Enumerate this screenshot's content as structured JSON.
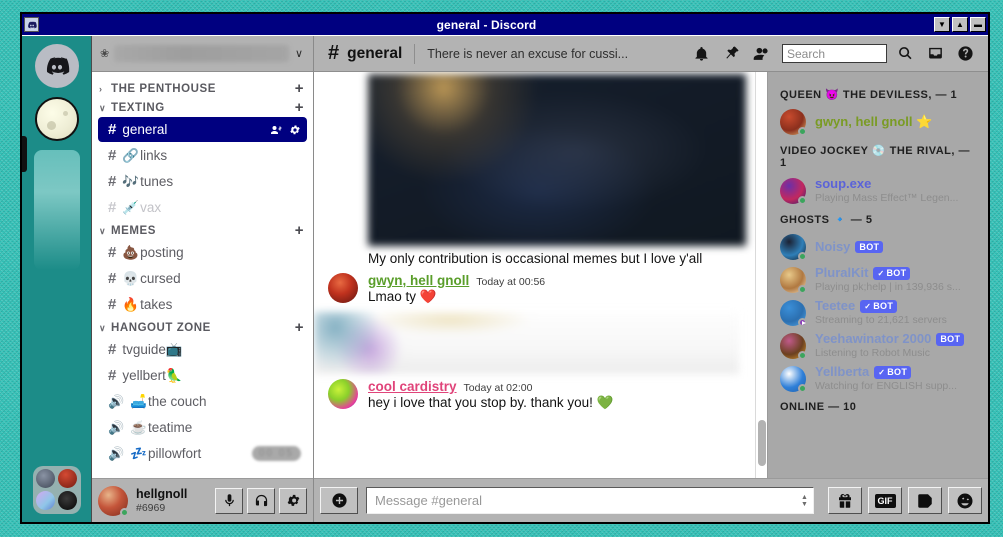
{
  "window": {
    "title": "general - Discord",
    "icon": "discord-icon",
    "buttons": [
      {
        "name": "minimize",
        "glyph": "▼"
      },
      {
        "name": "maximize",
        "glyph": "▲"
      },
      {
        "name": "close",
        "glyph": "▬"
      }
    ]
  },
  "server_rail": {
    "home_label": "Discord Home",
    "guilds": [
      {
        "name": "home"
      },
      {
        "name": "moon-server"
      },
      {
        "name": "faded-server"
      }
    ],
    "folder": {
      "name": "server-folder",
      "colors": [
        "#5b6470",
        "#a03028",
        "#cf7fe8",
        "#1a1a1a"
      ]
    }
  },
  "guild_header": {
    "emoji": "❀",
    "name": "",
    "chevron": "∨"
  },
  "channels": [
    {
      "category": "THE PENTHOUSE",
      "collapsed": true,
      "arrow": "›",
      "plus": "+",
      "items": []
    },
    {
      "category": "TEXTING",
      "collapsed": false,
      "arrow": "∨",
      "plus": "+",
      "items": [
        {
          "type": "text",
          "emoji": "",
          "name": "general",
          "active": true,
          "muted": false,
          "actions": [
            "create-invite-icon",
            "edit-channel-icon"
          ]
        },
        {
          "type": "text",
          "emoji": "🔗",
          "name": "links",
          "active": false,
          "muted": false
        },
        {
          "type": "text",
          "emoji": "🎶",
          "name": "tunes",
          "active": false,
          "muted": false
        },
        {
          "type": "text",
          "emoji": "💉",
          "name": "vax",
          "active": false,
          "muted": true
        }
      ]
    },
    {
      "category": "MEMES",
      "collapsed": false,
      "arrow": "∨",
      "plus": "+",
      "items": [
        {
          "type": "text",
          "emoji": "💩",
          "name": "posting",
          "active": false,
          "muted": false
        },
        {
          "type": "text",
          "emoji": "💀",
          "name": "cursed",
          "active": false,
          "muted": false
        },
        {
          "type": "text",
          "emoji": "🔥",
          "name": "takes",
          "active": false,
          "muted": false
        }
      ]
    },
    {
      "category": "HANGOUT ZONE",
      "collapsed": false,
      "arrow": "∨",
      "plus": "+",
      "items": [
        {
          "type": "text",
          "emoji": "",
          "name": "tvguide📺",
          "active": false,
          "muted": false
        },
        {
          "type": "text",
          "emoji": "",
          "name": "yellbert🦜",
          "active": false,
          "muted": false
        },
        {
          "type": "voice",
          "emoji": "🛋️",
          "name": "the couch",
          "active": false,
          "muted": false
        },
        {
          "type": "voice",
          "emoji": "☕",
          "name": "teatime",
          "active": false,
          "muted": false
        },
        {
          "type": "voice",
          "emoji": "💤",
          "name": "pillowfort",
          "active": false,
          "muted": false,
          "badge": "00  05"
        }
      ]
    }
  ],
  "user_panel": {
    "username": "hellgnoll",
    "discriminator": "#6969",
    "status": "online",
    "buttons": [
      {
        "name": "mute-button",
        "icon": "microphone-icon"
      },
      {
        "name": "deafen-button",
        "icon": "headphones-icon"
      },
      {
        "name": "user-settings-button",
        "icon": "gear-icon"
      }
    ]
  },
  "chat_header": {
    "hash": "#",
    "channel_name": "general",
    "topic": "There is never an excuse for cussi...",
    "icons": [
      {
        "name": "notifications-bell-icon"
      },
      {
        "name": "pinned-messages-icon"
      },
      {
        "name": "member-list-icon"
      }
    ],
    "search": {
      "placeholder": "Search",
      "icon": "search-icon"
    },
    "inbox_icon": "inbox-icon",
    "help_icon": "help-icon"
  },
  "messages": [
    {
      "type": "image-embed",
      "name": "image-attachment-dark",
      "author": "",
      "time": "",
      "content": ""
    },
    {
      "type": "text-continuation",
      "name": "message-text",
      "content": "My only contribution is occasional memes but I love y'all"
    },
    {
      "type": "message",
      "author": "gwyn, hell gnoll",
      "author_color": "#5a9e2a",
      "time": "Today at 00:56",
      "content": "Lmao ty ❤️",
      "attachment": "image-attachment-light"
    },
    {
      "type": "message",
      "author": "cool cardistry",
      "author_color": "#e0447a",
      "time": "Today at 02:00",
      "content": "hey i love that you stop by. thank you! 💚"
    }
  ],
  "member_list": {
    "groups": [
      {
        "title": "QUEEN 😈 THE DEVILESS, — 1",
        "name": "member-group-queen",
        "members": [
          {
            "name": "gwyn, hell gnoll ⭐",
            "color": "#7a9b24",
            "status": "online",
            "bot": false,
            "activity": "",
            "avatar_colors": [
              "#c94b2e",
              "#8b2f1d",
              "#e8c27a"
            ]
          }
        ]
      },
      {
        "title": "VIDEO JOCKEY 💿 THE RIVAL, — 1",
        "name": "member-group-video-jockey",
        "members": [
          {
            "name": "soup.exe",
            "color": "#5b63d8",
            "status": "online",
            "bot": false,
            "activity": "Playing Mass Effect™ Legen...",
            "avatar_colors": [
              "#6b2fa8",
              "#c2285f",
              "#2b2070"
            ]
          }
        ]
      },
      {
        "title": "GHOSTS 🔹 — 5",
        "name": "member-group-ghosts",
        "members": [
          {
            "name": "Noisy",
            "color": "#7f93c8",
            "status": "online",
            "bot": true,
            "bot_verified": false,
            "bot_label": "BOT",
            "activity": "",
            "avatar_colors": [
              "#1c2233",
              "#2f7fb8",
              "#10141f"
            ]
          },
          {
            "name": "PluralKit",
            "color": "#7f93c8",
            "status": "online",
            "bot": true,
            "bot_verified": true,
            "bot_label": "BOT",
            "activity": "Playing pk;help | in 139,936 s...",
            "avatar_colors": [
              "#e8c98a",
              "#b07840",
              "#f7e3c2"
            ]
          },
          {
            "name": "Teetee",
            "color": "#7f93c8",
            "status": "streaming",
            "bot": true,
            "bot_verified": true,
            "bot_label": "BOT",
            "activity": "Streaming to 21,621 servers",
            "avatar_colors": [
              "#3b8fd8",
              "#2b6fb0",
              "#55a8e8"
            ]
          },
          {
            "name": "Yeehawinator 2000",
            "color": "#7f93c8",
            "status": "online",
            "bot": true,
            "bot_verified": false,
            "bot_label": "BOT",
            "activity": "Listening to Robot Music",
            "avatar_colors": [
              "#c05a8a",
              "#6b4020",
              "#e0a030"
            ]
          },
          {
            "name": "Yellberta",
            "color": "#7f93c8",
            "status": "online",
            "bot": true,
            "bot_verified": true,
            "bot_label": "BOT",
            "activity": "Watching for ENGLISH supp...",
            "avatar_colors": [
              "#ffffff",
              "#2f7fd8",
              "#1f5fa8"
            ]
          }
        ]
      },
      {
        "title": "ONLINE — 10",
        "name": "member-group-online",
        "members": []
      }
    ]
  },
  "compose": {
    "add_button": "add-attachment-button",
    "placeholder": "Message #general",
    "value": "",
    "buttons": [
      {
        "name": "gift-button",
        "icon": "gift-icon"
      },
      {
        "name": "gif-button",
        "icon": "gif-icon",
        "label": "GIF"
      },
      {
        "name": "sticker-button",
        "icon": "sticker-icon"
      },
      {
        "name": "emoji-button",
        "icon": "emoji-icon"
      }
    ],
    "spinner_up": "▲",
    "spinner_down": "▼"
  },
  "colors": {
    "titlebar": "#000080",
    "active_channel": "#000080",
    "chrome": "#c0c0c0",
    "desktop": "#2fbfb5",
    "online": "#3ba55d",
    "bot_badge": "#5865f2"
  }
}
